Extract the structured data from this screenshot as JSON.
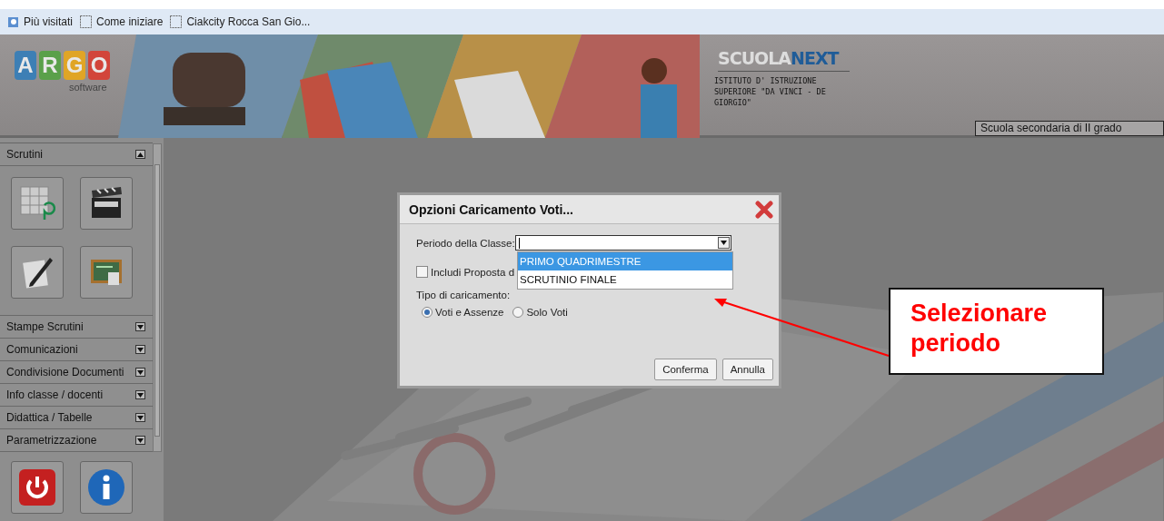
{
  "bookmarks": [
    {
      "label": "Più visitati",
      "kind": "history"
    },
    {
      "label": "Come iniziare",
      "kind": "page"
    },
    {
      "label": "Ciakcity Rocca San Gio...",
      "kind": "page"
    }
  ],
  "banner": {
    "logo_letters": [
      {
        "letter": "A",
        "color": "#3d7fb5"
      },
      {
        "letter": "R",
        "color": "#5aa04a"
      },
      {
        "letter": "G",
        "color": "#e0a526"
      },
      {
        "letter": "O",
        "color": "#d2453a"
      }
    ],
    "logo_caption": "software",
    "product_primary": "SCUOLA",
    "product_accent": "NEXT",
    "institute": "ISTITUTO D' ISTRUZIONE SUPERIORE \"DA VINCI - DE GIORGIO\"",
    "school_type": "Scuola secondaria di II grado"
  },
  "sidebar": {
    "sections": [
      {
        "label": "Scrutini",
        "expanded": true,
        "tools": [
          {
            "kind": "grid-nine"
          },
          {
            "kind": "clapperboard"
          },
          {
            "kind": "pencil-paper"
          },
          {
            "kind": "chalkboard"
          }
        ]
      },
      {
        "label": "Stampe Scrutini",
        "expanded": false
      },
      {
        "label": "Comunicazioni",
        "expanded": false
      },
      {
        "label": "Condivisione Documenti",
        "expanded": false
      },
      {
        "label": "Info classe / docenti",
        "expanded": false
      },
      {
        "label": "Didattica / Tabelle",
        "expanded": false
      },
      {
        "label": "Parametrizzazione",
        "expanded": false
      }
    ],
    "footer_tools": [
      {
        "kind": "power"
      },
      {
        "kind": "info"
      }
    ]
  },
  "dialog": {
    "title": "Opzioni Caricamento Voti...",
    "period_label": "Periodo della Classe:",
    "period_options": [
      {
        "label": "PRIMO QUADRIMESTRE",
        "selected": true
      },
      {
        "label": "SCRUTINIO FINALE",
        "selected": false
      }
    ],
    "include_label": "Includi Proposta d",
    "include_checked": false,
    "type_label": "Tipo di caricamento:",
    "types": [
      {
        "label": "Voti e Assenze",
        "selected": true
      },
      {
        "label": "Solo Voti",
        "selected": false
      }
    ],
    "buttons": [
      "Conferma",
      "Annulla"
    ]
  },
  "callout": {
    "text": "Selezionare periodo"
  }
}
